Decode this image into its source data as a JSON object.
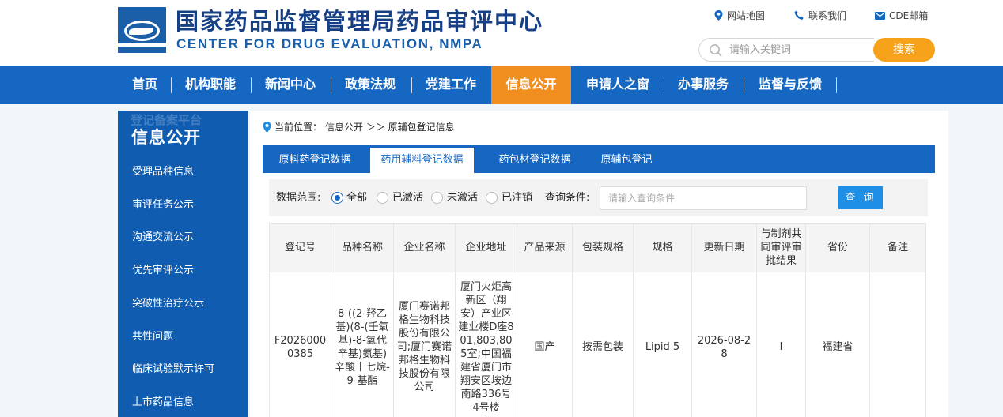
{
  "header": {
    "title": "国家药品监督管理局药品审评中心",
    "subtitle": "CENTER FOR DRUG EVALUATION, NMPA",
    "links": [
      {
        "label": "网站地图",
        "icon": "location-pin-icon"
      },
      {
        "label": "联系我们",
        "icon": "phone-icon"
      },
      {
        "label": "CDE邮箱",
        "icon": "mail-icon"
      }
    ],
    "search_placeholder": "请输入关键词",
    "search_button": "搜索"
  },
  "nav": {
    "items": [
      "首页",
      "机构职能",
      "新闻中心",
      "政策法规",
      "党建工作",
      "信息公开",
      "申请人之窗",
      "办事服务",
      "监督与反馈"
    ],
    "active_index": 5
  },
  "sidebar": {
    "ghost_text": "登记备案平台",
    "title": "信息公开",
    "items": [
      "受理品种信息",
      "审评任务公示",
      "沟通交流公示",
      "优先审评公示",
      "突破性治疗公示",
      "共性问题",
      "临床试验默示许可",
      "上市药品信息"
    ]
  },
  "breadcrumb": {
    "prefix": "当前位置：",
    "path": "信息公开 ＞＞ 原辅包登记信息"
  },
  "tabs": {
    "items": [
      "原料药登记数据",
      "药用辅料登记数据",
      "药包材登记数据",
      "原辅包登记"
    ],
    "active_index": 1
  },
  "filter": {
    "scope_label": "数据范围:",
    "options": [
      "全部",
      "已激活",
      "未激活",
      "已注销"
    ],
    "selected_index": 0,
    "query_label": "查询条件:",
    "query_placeholder": "请输入查询条件",
    "query_button": "查 询"
  },
  "table": {
    "headers": [
      "登记号",
      "品种名称",
      "企业名称",
      "企业地址",
      "产品来源",
      "包装规格",
      "规格",
      "更新日期",
      "与制剂共同审评审批结果",
      "省份",
      "备注"
    ],
    "rows": [
      [
        "F20260000385",
        "8-((2-羟乙基)(8-(壬氧基)-8-氧代辛基)氨基)辛酸十七烷-9-基酯",
        "厦门赛诺邦格生物科技股份有限公司;厦门赛诺邦格生物科技股份有限公司",
        "厦门火炬高新区（翔安）产业区建业楼D座801,803,805室;中国福建省厦门市翔安区垵边南路336号4号楼",
        "国产",
        "按需包装",
        "Lipid 5",
        "2026-08-28",
        "I",
        "福建省",
        ""
      ]
    ]
  },
  "colors": {
    "brand_blue": "#1667c2",
    "sidebar_blue": "#0f5cb1",
    "accent_orange": "#f18e20",
    "search_orange": "#f7a21b"
  }
}
